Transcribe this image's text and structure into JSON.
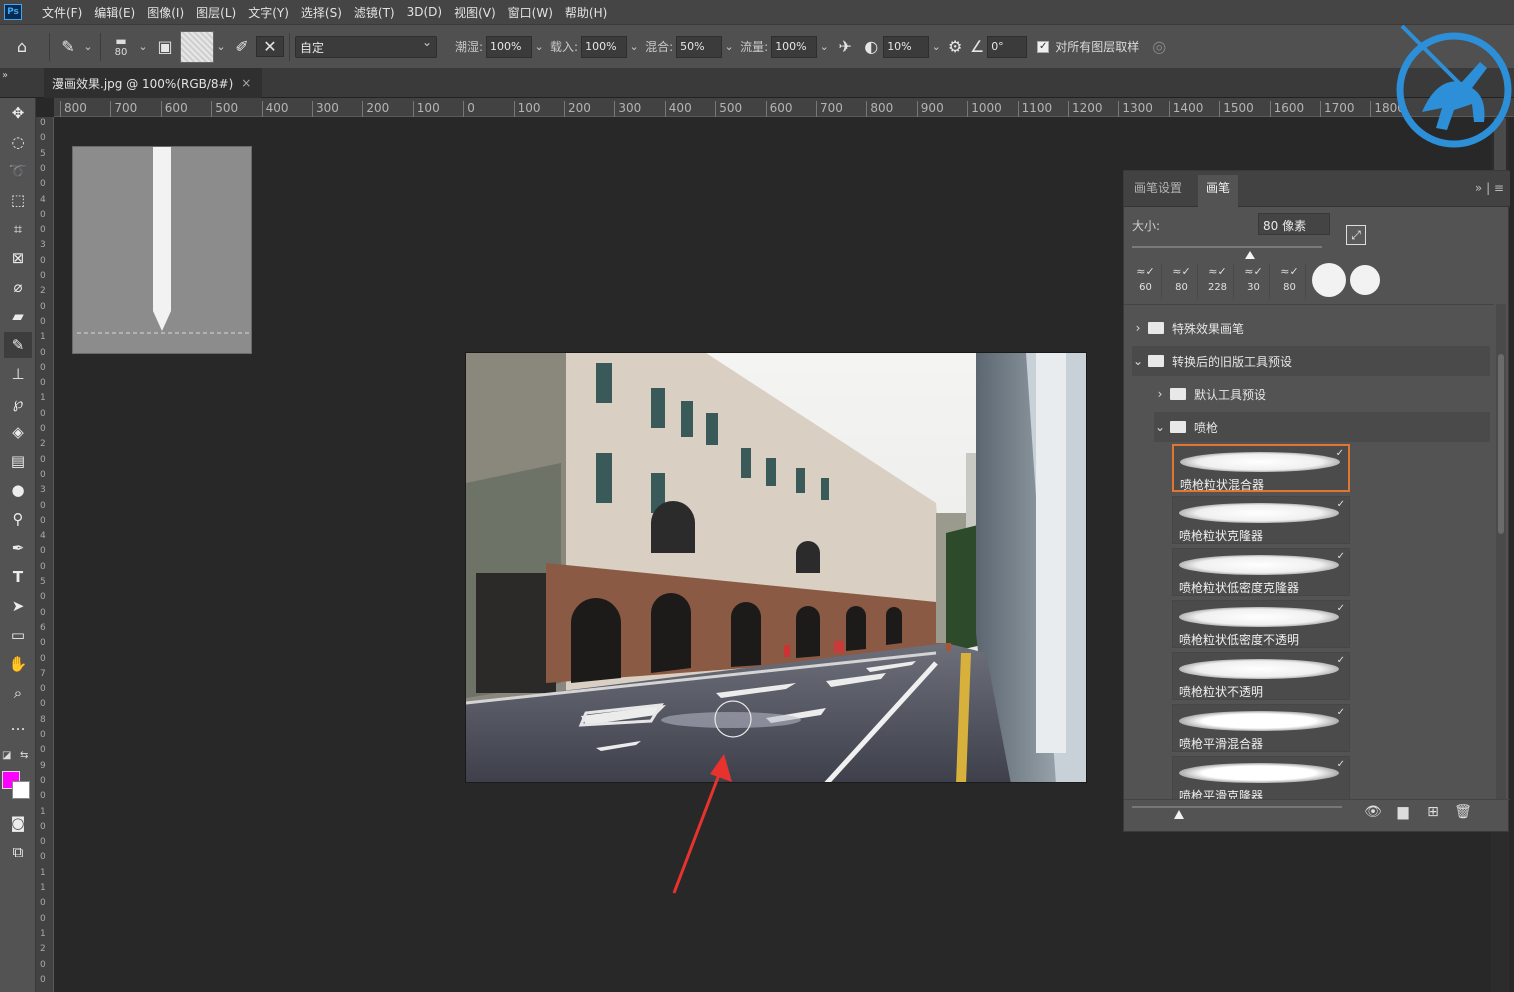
{
  "menu": [
    "文件(F)",
    "编辑(E)",
    "图像(I)",
    "图层(L)",
    "文字(Y)",
    "选择(S)",
    "滤镜(T)",
    "3D(D)",
    "视图(V)",
    "窗口(W)",
    "帮助(H)"
  ],
  "app_logo": "Ps",
  "options": {
    "brush_size": "80",
    "preset_mode": "自定",
    "wet_label": "潮湿:",
    "wet_value": "100%",
    "load_label": "载入:",
    "load_value": "100%",
    "mix_label": "混合:",
    "mix_value": "50%",
    "flow_label": "流量:",
    "flow_value": "100%",
    "smooth_value": "10%",
    "angle_value": "0°",
    "sample_all_label": "对所有图层取样"
  },
  "document_tab": {
    "title": "漫画效果.jpg @ 100%(RGB/8#)",
    "close": "×"
  },
  "ruler_h": [
    "800",
    "700",
    "600",
    "500",
    "400",
    "300",
    "200",
    "100",
    "0",
    "100",
    "200",
    "300",
    "400",
    "500",
    "600",
    "700",
    "800",
    "900",
    "1000",
    "1100",
    "1200",
    "1300",
    "1400",
    "1500",
    "1600",
    "1700",
    "1800"
  ],
  "ruler_v": [
    "0",
    "0",
    "5",
    "0",
    "0",
    "4",
    "0",
    "0",
    "3",
    "0",
    "0",
    "2",
    "0",
    "0",
    "1",
    "0",
    "0",
    "0",
    "1",
    "0",
    "0",
    "2",
    "0",
    "0",
    "3",
    "0",
    "0",
    "4",
    "0",
    "0",
    "5",
    "0",
    "0",
    "6",
    "0",
    "0",
    "7",
    "0",
    "0",
    "8",
    "0",
    "0",
    "9",
    "0",
    "0",
    "1",
    "0",
    "0",
    "0",
    "1",
    "1",
    "0",
    "0",
    "1",
    "2",
    "0",
    "0"
  ],
  "colors": {
    "foreground": "#ff00ff",
    "background": "#ffffff",
    "selection_border": "#e0762f",
    "arrow": "#e8322e",
    "logo_blue": "#2d8fd8"
  },
  "brush_panel": {
    "tabs": [
      "画笔设置",
      "画笔"
    ],
    "size_label": "大小:",
    "size_value": "80 像素",
    "size_slider_fraction": 0.62,
    "presets": [
      "60",
      "80",
      "228",
      "30",
      "80"
    ],
    "folders": [
      {
        "name": "特殊效果画笔",
        "expanded": false
      },
      {
        "name": "转换后的旧版工具预设",
        "expanded": true
      },
      {
        "name": "默认工具预设",
        "expanded": false
      },
      {
        "name": "喷枪",
        "expanded": true
      }
    ],
    "brushes": [
      "喷枪粒状混合器",
      "喷枪粒状克隆器",
      "喷枪粒状低密度克隆器",
      "喷枪粒状低密度不透明",
      "喷枪粒状不透明",
      "喷枪平滑混合器",
      "喷枪平滑克隆器"
    ]
  }
}
